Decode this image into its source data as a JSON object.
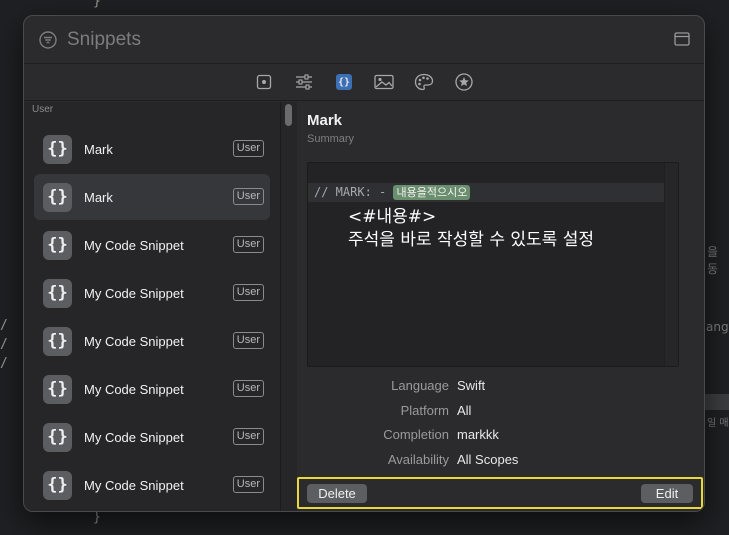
{
  "background": {
    "brace_top": "}",
    "brace_bottom": "}",
    "right_fragments": [
      "을 동",
      "ange",
      "일 매"
    ],
    "left_slashes": [
      "/",
      "/",
      "/"
    ]
  },
  "window": {
    "title": "Snippets",
    "title_icon": "filter-circle-icon",
    "layout_button_icon": "sidebar-toggle-icon"
  },
  "toolbar": {
    "tabs": [
      {
        "icon": "square-dot-icon",
        "active": false
      },
      {
        "icon": "sliders-icon",
        "active": false
      },
      {
        "icon": "curly-braces-icon",
        "label": "{}",
        "active": true
      },
      {
        "icon": "image-icon",
        "active": false
      },
      {
        "icon": "palette-icon",
        "active": false
      },
      {
        "icon": "star-circle-icon",
        "active": false
      }
    ]
  },
  "sidebar": {
    "section_header": "User",
    "items": [
      {
        "icon_text": "{}",
        "label": "Mark",
        "badge": "User",
        "selected": false
      },
      {
        "icon_text": "{}",
        "label": "Mark",
        "badge": "User",
        "selected": true
      },
      {
        "icon_text": "{}",
        "label": "My Code Snippet",
        "badge": "User",
        "selected": false
      },
      {
        "icon_text": "{}",
        "label": "My Code Snippet",
        "badge": "User",
        "selected": false
      },
      {
        "icon_text": "{}",
        "label": "My Code Snippet",
        "badge": "User",
        "selected": false
      },
      {
        "icon_text": "{}",
        "label": "My Code Snippet",
        "badge": "User",
        "selected": false
      },
      {
        "icon_text": "{}",
        "label": "My Code Snippet",
        "badge": "User",
        "selected": false
      },
      {
        "icon_text": "{}",
        "label": "My Code Snippet",
        "badge": "User",
        "selected": false
      }
    ]
  },
  "detail": {
    "title": "Mark",
    "subtitle": "Summary",
    "code": {
      "prefix": "// MARK: - ",
      "placeholder": "내용을적으시오",
      "annotation_line1": "<#내용#>",
      "annotation_line2": "주석을 바로 작성할 수 있도록 설정"
    },
    "properties": [
      {
        "key": "Language",
        "value": "Swift"
      },
      {
        "key": "Platform",
        "value": "All"
      },
      {
        "key": "Completion",
        "value": "markkk"
      },
      {
        "key": "Availability",
        "value": "All Scopes"
      }
    ],
    "actions": {
      "delete_label": "Delete",
      "edit_label": "Edit",
      "highlight_color": "#e9d83a"
    }
  }
}
